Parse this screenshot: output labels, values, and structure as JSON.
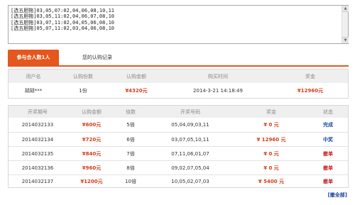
{
  "order_lines": [
    "[选五胆拖]03,05,07:02,04,06,08,10,11",
    "[选五胆拖]03,05,11:02,04,06,07,08,10",
    "[选五胆拖]03,07,11:02,04,05,06,08,10",
    "[选五胆拖]05,07,11:02,03,04,06,08,10"
  ],
  "tabs": {
    "participants": "参与合人数1人",
    "my_records": "您的认购记录"
  },
  "participant_table": {
    "headers": [
      "用户名",
      "认购份数",
      "认购金额",
      "购买时间",
      "奖金"
    ],
    "row": {
      "user": "胡胡***",
      "shares": "1份",
      "amount": "¥4320元",
      "time": "2014-3-21 14:18:49",
      "prize": "¥12960元"
    }
  },
  "draw_table": {
    "headers": [
      "开奖期号",
      "认购金额",
      "倍数",
      "开奖号码",
      "奖金",
      "状态"
    ],
    "rows": [
      {
        "period": "2014032133",
        "amount": "¥600元",
        "multiple": "5倍",
        "numbers": "05,04,09,03,11",
        "prize": "¥ 0 元",
        "status": "完成",
        "status_type": "done"
      },
      {
        "period": "2014032134",
        "amount": "¥720元",
        "multiple": "6倍",
        "numbers": "03,07,05,10,11",
        "prize": "¥ 12960 元",
        "status": "中奖",
        "status_type": "win"
      },
      {
        "period": "2014032135",
        "amount": "¥840元",
        "multiple": "7倍",
        "numbers": "07,11,06,01,07",
        "prize": "¥ 0 元",
        "status": "撤单",
        "status_type": "cancel"
      },
      {
        "period": "2014032136",
        "amount": "¥960元",
        "multiple": "8倍",
        "numbers": "09,02,07,05,04",
        "prize": "¥ 0 元",
        "status": "撤单",
        "status_type": "cancel"
      },
      {
        "period": "2014032137",
        "amount": "¥1200元",
        "multiple": "10倍",
        "numbers": "10,05,02,07,03",
        "prize": "¥ 5400 元",
        "status": "撤单",
        "status_type": "cancel"
      }
    ]
  },
  "cancel_all_label": "[撤全部]"
}
